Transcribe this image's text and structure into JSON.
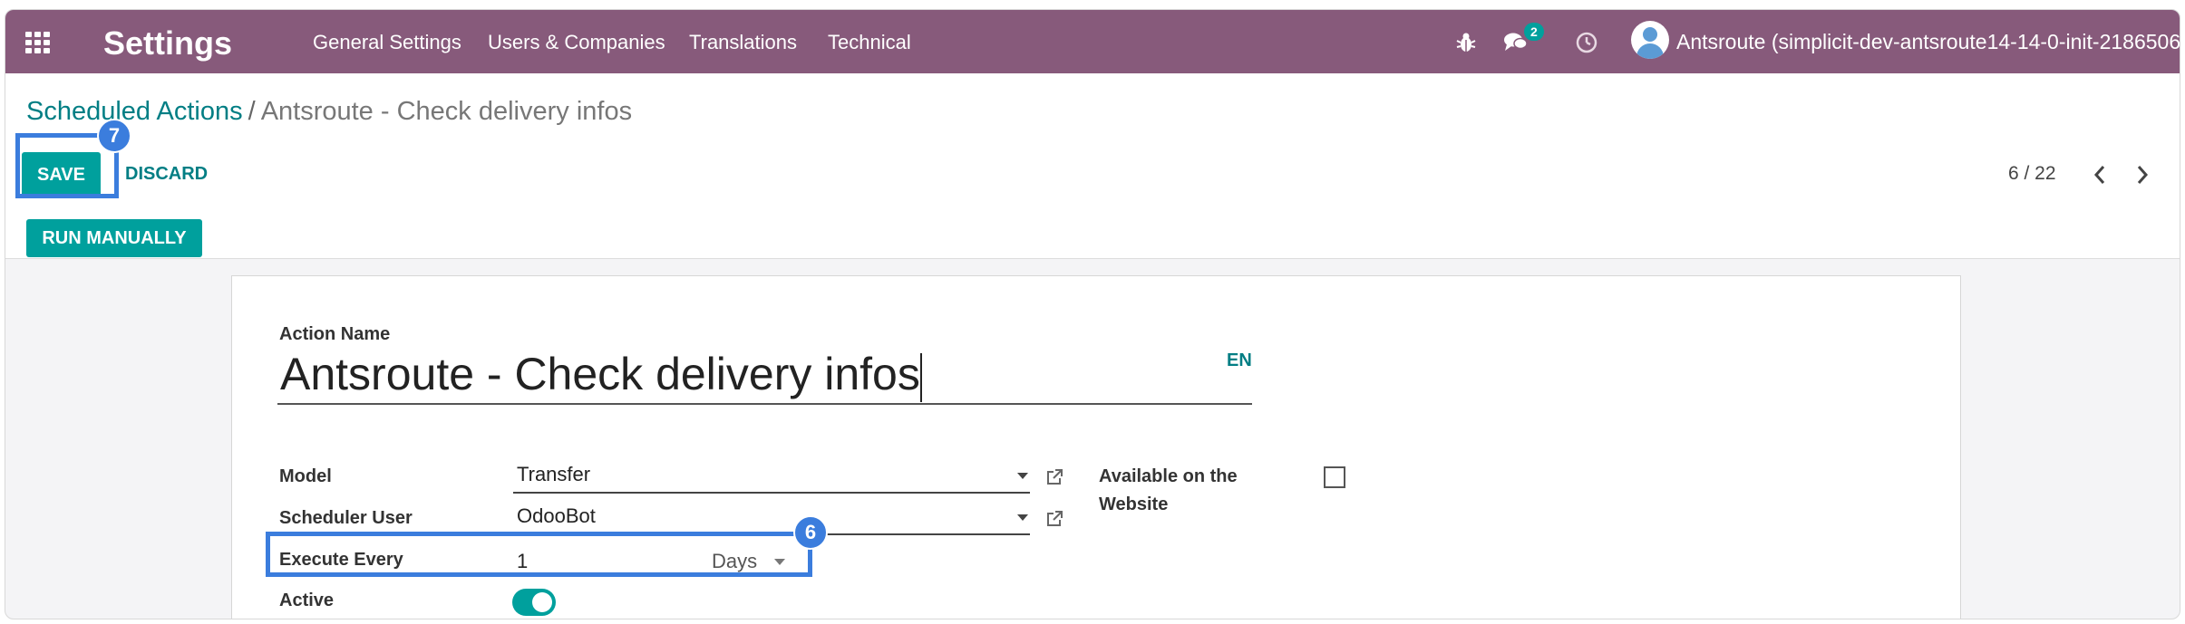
{
  "navbar": {
    "brand": "Settings",
    "menus": [
      "General Settings",
      "Users & Companies",
      "Translations",
      "Technical"
    ],
    "messages_badge": "2",
    "user": "Antsroute (simplicit-dev-antsroute14-14-0-init-2186506)",
    "bg_color": "#875a7b"
  },
  "breadcrumb": {
    "parent": "Scheduled Actions",
    "separator": "/",
    "current": "Antsroute - Check delivery infos"
  },
  "buttons": {
    "save": "SAVE",
    "discard": "DISCARD",
    "run_manually": "RUN MANUALLY"
  },
  "pager": {
    "value": "6 / 22"
  },
  "form": {
    "action_name_label": "Action Name",
    "action_name_value": "Antsroute - Check delivery infos",
    "lang": "EN",
    "model_label": "Model",
    "model_value": "Transfer",
    "scheduler_user_label": "Scheduler User",
    "scheduler_user_value": "OdooBot",
    "execute_every_label": "Execute Every",
    "execute_every_value": "1",
    "execute_every_unit": "Days",
    "active_label": "Active",
    "active_value": true,
    "available_website_label_1": "Available on the",
    "available_website_label_2": "Website",
    "available_website_value": false
  },
  "annotations": {
    "save_marker": "7",
    "execute_every_marker": "6",
    "highlight_color": "#3b7ddd"
  },
  "colors": {
    "accent": "#00a09d",
    "link": "#017e84"
  }
}
